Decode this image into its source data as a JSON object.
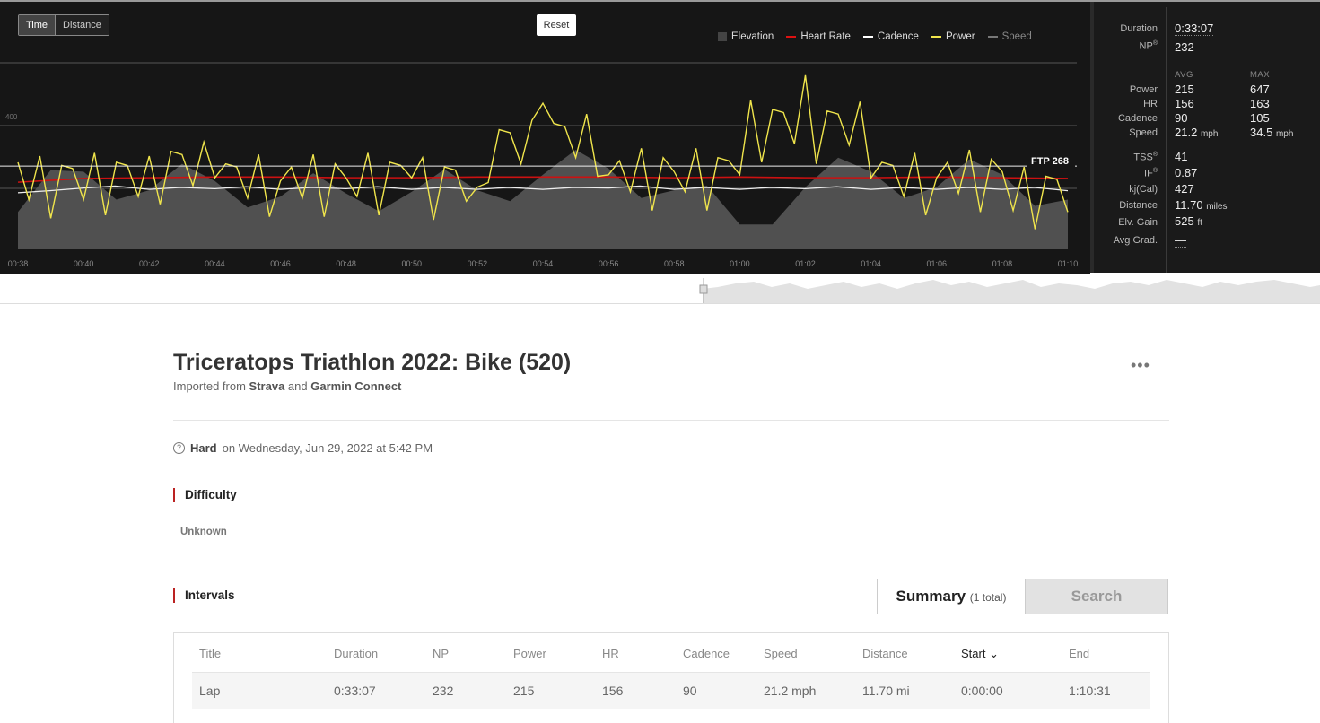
{
  "chart_data": {
    "type": "line",
    "xlabel": "",
    "ylabel": "",
    "x_ticks": [
      "00:38",
      "00:40",
      "00:42",
      "00:44",
      "00:46",
      "00:48",
      "00:50",
      "00:52",
      "00:54",
      "00:56",
      "00:58",
      "01:00",
      "01:02",
      "01:04",
      "01:06",
      "01:08",
      "01:10"
    ],
    "y_ticks": [
      "400"
    ],
    "series": [
      {
        "name": "Elevation",
        "color": "#444444",
        "x": [
          0,
          1,
          2,
          3,
          4,
          5,
          6,
          7,
          8,
          9,
          10,
          11,
          12,
          13,
          14,
          15,
          16
        ],
        "values": [
          120,
          250,
          190,
          220,
          170,
          180,
          185,
          190,
          240,
          260,
          190,
          80,
          200,
          250,
          200,
          240,
          160
        ]
      },
      {
        "name": "Heart Rate",
        "color": "#cc1111",
        "x": [
          0,
          1,
          2,
          3,
          4,
          5,
          6,
          7,
          8,
          9,
          10,
          11,
          12,
          13,
          14,
          15,
          16
        ],
        "values": [
          150,
          155,
          156,
          157,
          157,
          156,
          156,
          157,
          157,
          157,
          156,
          157,
          156,
          156,
          157,
          156,
          155
        ]
      },
      {
        "name": "Cadence",
        "color": "#ffffff",
        "x": [
          0,
          1,
          2,
          3,
          4,
          5,
          6,
          7,
          8,
          9,
          10,
          11,
          12,
          13,
          14,
          15,
          16
        ],
        "values": [
          85,
          92,
          90,
          91,
          90,
          91,
          90,
          90,
          90,
          92,
          90,
          90,
          91,
          90,
          90,
          90,
          88
        ]
      },
      {
        "name": "Power",
        "color": "#f0e54c",
        "x": [
          0,
          1,
          2,
          3,
          4,
          5,
          6,
          7,
          8,
          9,
          10,
          11,
          12,
          13,
          14,
          15,
          16
        ],
        "values": [
          280,
          160,
          300,
          230,
          220,
          230,
          230,
          200,
          470,
          240,
          250,
          240,
          560,
          230,
          230,
          250,
          120
        ]
      },
      {
        "name": "Speed",
        "color": "#777777",
        "x": [],
        "values": []
      }
    ],
    "annotations": [
      "FTP 268"
    ],
    "ftp": 268,
    "legend_position": "top-right"
  },
  "chart_ui": {
    "toggle": [
      "Time",
      "Distance"
    ],
    "reset_label": "Reset",
    "ftp_label": "FTP 268"
  },
  "stats": {
    "duration_label": "Duration",
    "duration": "0:33:07",
    "np_label": "NP",
    "np": "232",
    "avg_header": "AVG",
    "max_header": "MAX",
    "rows": [
      {
        "label": "Power",
        "avg": "215",
        "max": "647",
        "unit": ""
      },
      {
        "label": "HR",
        "avg": "156",
        "max": "163",
        "unit": ""
      },
      {
        "label": "Cadence",
        "avg": "90",
        "max": "105",
        "unit": ""
      },
      {
        "label": "Speed",
        "avg": "21.2",
        "max": "34.5",
        "unit": "mph"
      }
    ],
    "tss_label": "TSS",
    "tss": "41",
    "if_label": "IF",
    "if": "0.87",
    "kj_label": "kj(Cal)",
    "kj": "427",
    "distance_label": "Distance",
    "distance": "11.70",
    "distance_unit": "miles",
    "elv_label": "Elv. Gain",
    "elv": "525",
    "elv_unit": "ft",
    "grad_label": "Avg Grad.",
    "grad": "—"
  },
  "page": {
    "title": "Triceratops Triathlon 2022: Bike (520)",
    "imported_prefix": "Imported from",
    "source1": "Strava",
    "and": "and",
    "source2": "Garmin Connect",
    "more": "•••",
    "question": "?",
    "effort": "Hard",
    "date_text": "on Wednesday, Jun 29, 2022 at 5:42 PM",
    "difficulty_title": "Difficulty",
    "difficulty_value": "Unknown",
    "intervals_title": "Intervals",
    "tab_summary": "Summary",
    "tab_summary_count": "(1 total)",
    "tab_search": "Search"
  },
  "table": {
    "headers": [
      "Title",
      "Duration",
      "NP",
      "Power",
      "HR",
      "Cadence",
      "Speed",
      "Distance",
      "Start",
      "End"
    ],
    "sort_arrow": "⌄",
    "row": [
      "Lap",
      "0:33:07",
      "232",
      "215",
      "156",
      "90",
      "21.2 mph",
      "11.70 mi",
      "0:00:00",
      "1:10:31"
    ]
  }
}
